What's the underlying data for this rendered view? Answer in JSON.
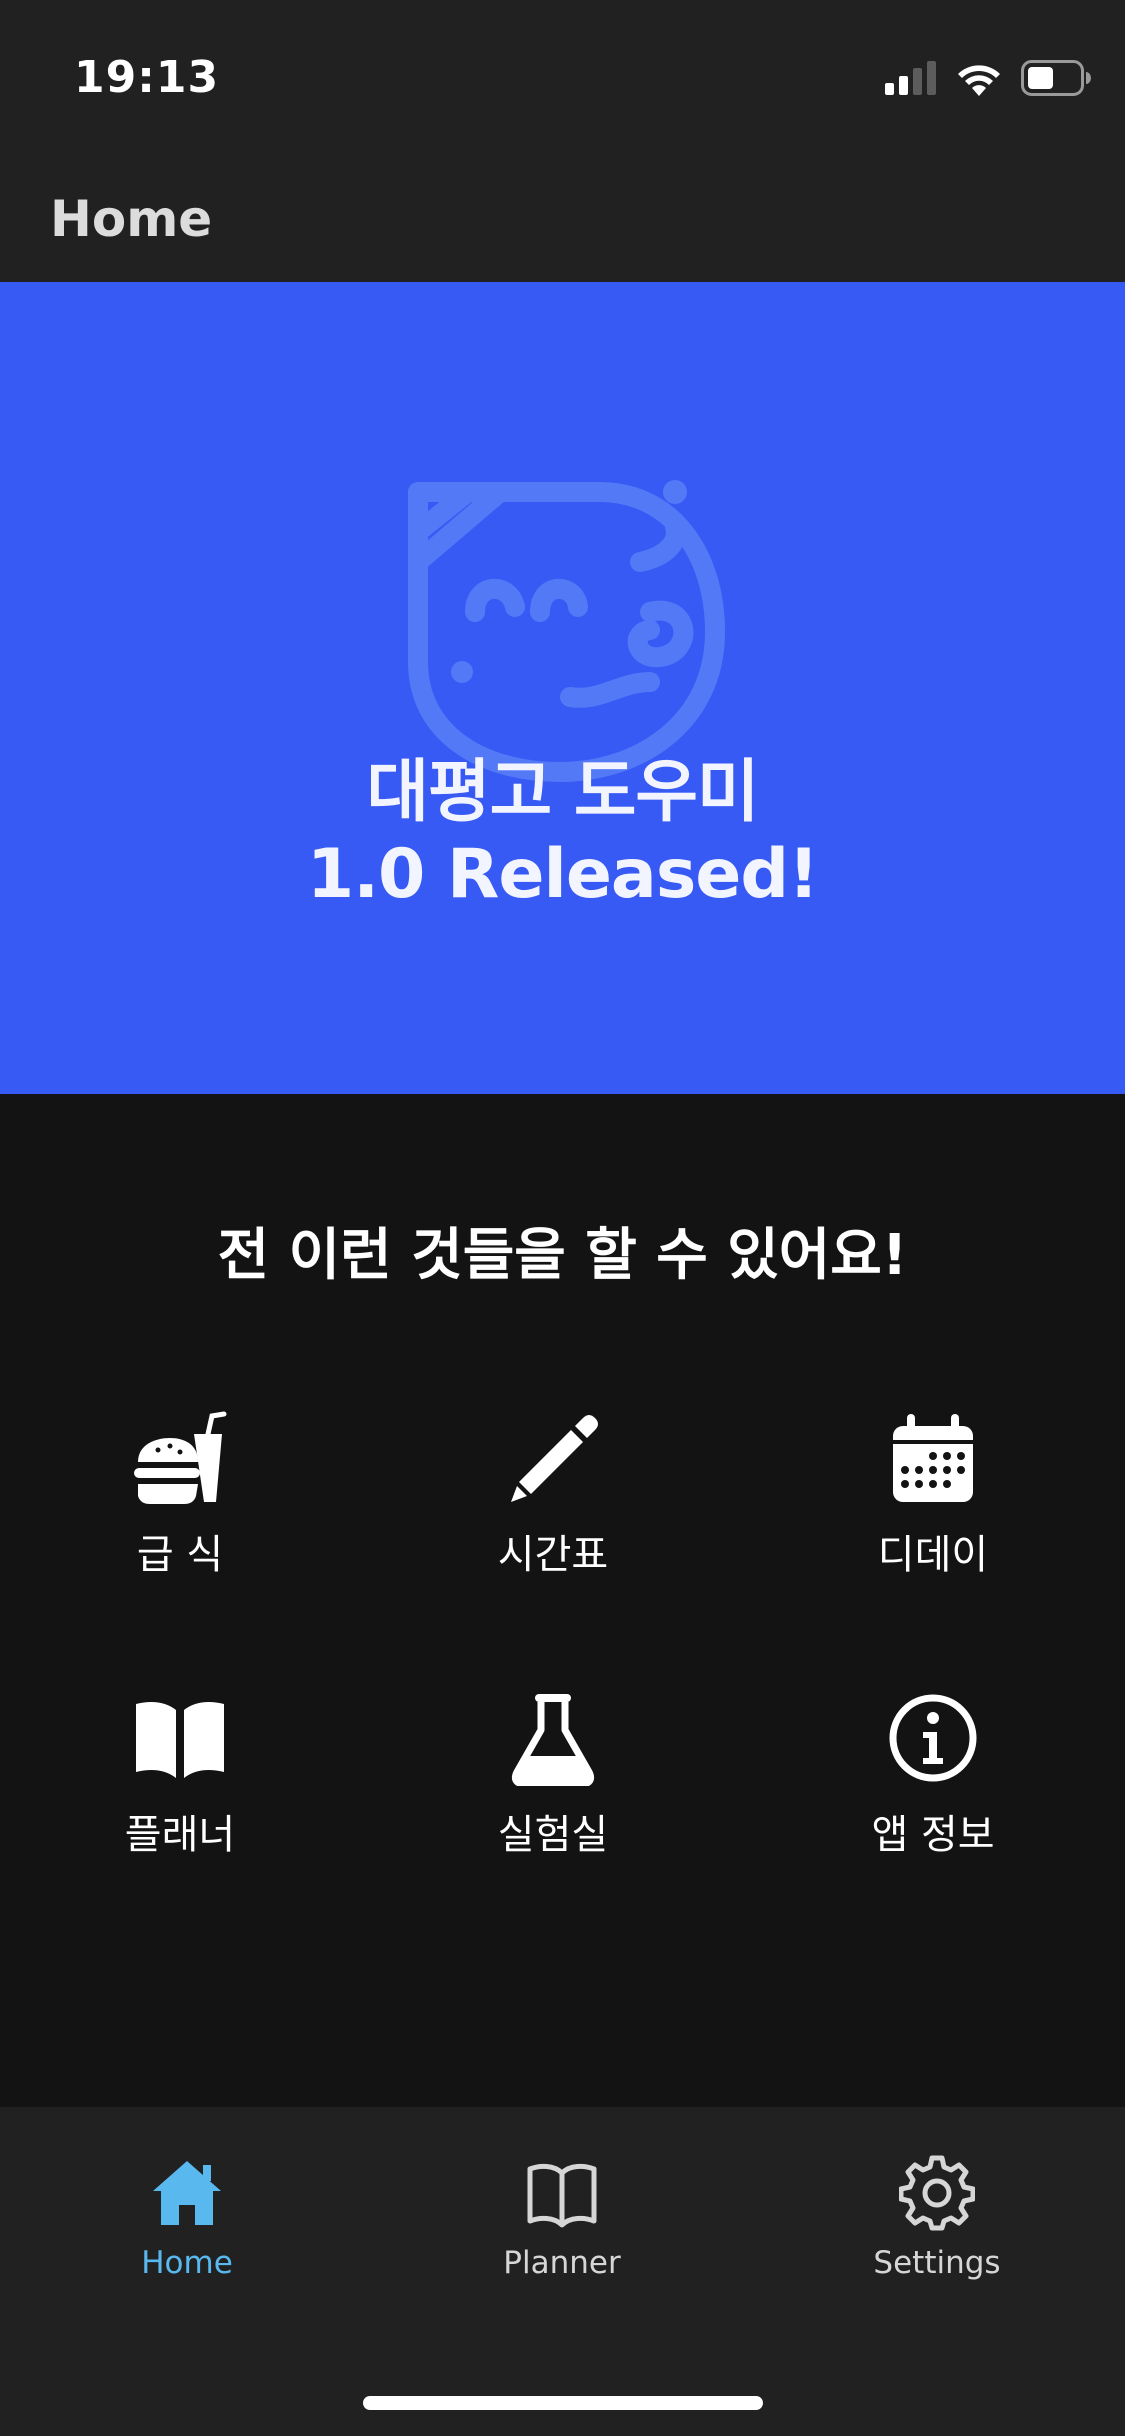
{
  "status_bar": {
    "time": "19:13"
  },
  "app_bar": {
    "title": "Home"
  },
  "banner": {
    "line1": "대평고 도우미",
    "line2": "1.0 Released!",
    "background_color": "#375af5"
  },
  "main": {
    "section_title": "전 이런 것들을 할 수 있어요!",
    "features": [
      {
        "label": "급 식",
        "icon": "burger-drink-icon"
      },
      {
        "label": "시간표",
        "icon": "pencil-icon"
      },
      {
        "label": "디데이",
        "icon": "calendar-icon"
      },
      {
        "label": "플래너",
        "icon": "book-icon"
      },
      {
        "label": "실험실",
        "icon": "flask-icon"
      },
      {
        "label": "앱 정보",
        "icon": "info-icon"
      }
    ]
  },
  "tab_bar": {
    "tabs": [
      {
        "label": "Home",
        "icon": "home-icon",
        "active": true
      },
      {
        "label": "Planner",
        "icon": "book-outline-icon",
        "active": false
      },
      {
        "label": "Settings",
        "icon": "gear-icon",
        "active": false
      }
    ],
    "active_color": "#59b9ef"
  }
}
